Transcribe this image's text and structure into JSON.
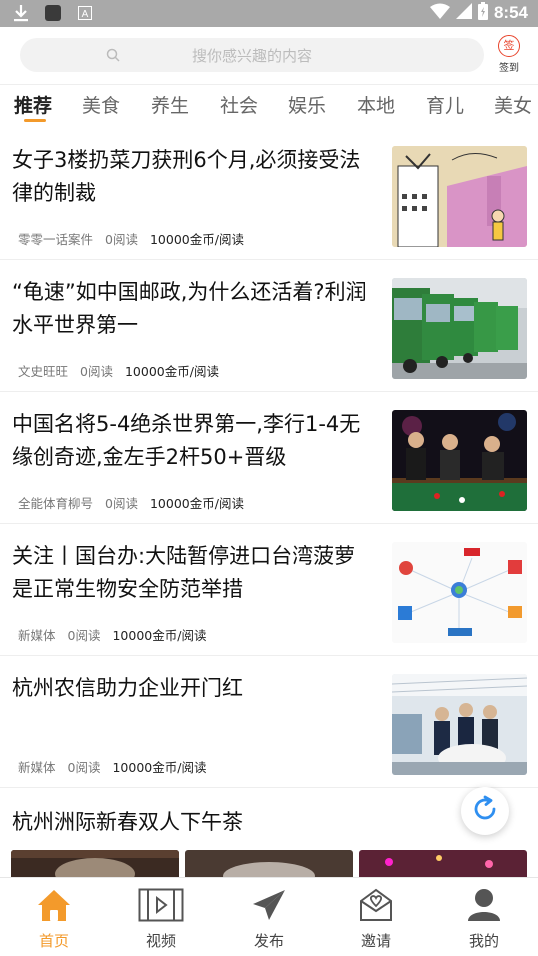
{
  "status_bar": {
    "time": "8:54"
  },
  "header": {
    "search_placeholder": "搜你感兴趣的内容",
    "signin_icon_text": "签",
    "signin_label": "签到"
  },
  "tabs": [
    "推荐",
    "美食",
    "养生",
    "社会",
    "娱乐",
    "本地",
    "育儿",
    "美女"
  ],
  "articles": [
    {
      "title": "女子3楼扔菜刀获刑6个月,必须接受法律的制裁",
      "source": "零零一话案件",
      "reads": "0阅读",
      "reward": "10000金币/阅读"
    },
    {
      "title": "“龟速”如中国邮政,为什么还活着?利润水平世界第一",
      "source": "文史旺旺",
      "reads": "0阅读",
      "reward": "10000金币/阅读"
    },
    {
      "title": "中国名将5-4绝杀世界第一,李行1-4无缘创奇迹,金左手2杆50+晋级",
      "source": "全能体育柳号",
      "reads": "0阅读",
      "reward": "10000金币/阅读"
    },
    {
      "title": "关注丨国台办:大陆暂停进口台湾菠萝是正常生物安全防范举措",
      "source": "新媒体",
      "reads": "0阅读",
      "reward": "10000金币/阅读"
    },
    {
      "title": "杭州农信助力企业开门红",
      "source": "新媒体",
      "reads": "0阅读",
      "reward": "10000金币/阅读"
    }
  ],
  "last_article": {
    "title": "杭州洲际新春双人下午茶"
  },
  "bottom_nav": [
    {
      "label": "首页"
    },
    {
      "label": "视频"
    },
    {
      "label": "发布"
    },
    {
      "label": "邀请"
    },
    {
      "label": "我的"
    }
  ],
  "colors": {
    "accent": "#f39a2b",
    "signin_red": "#e8442c",
    "status_bar": "#a9a9a9"
  }
}
